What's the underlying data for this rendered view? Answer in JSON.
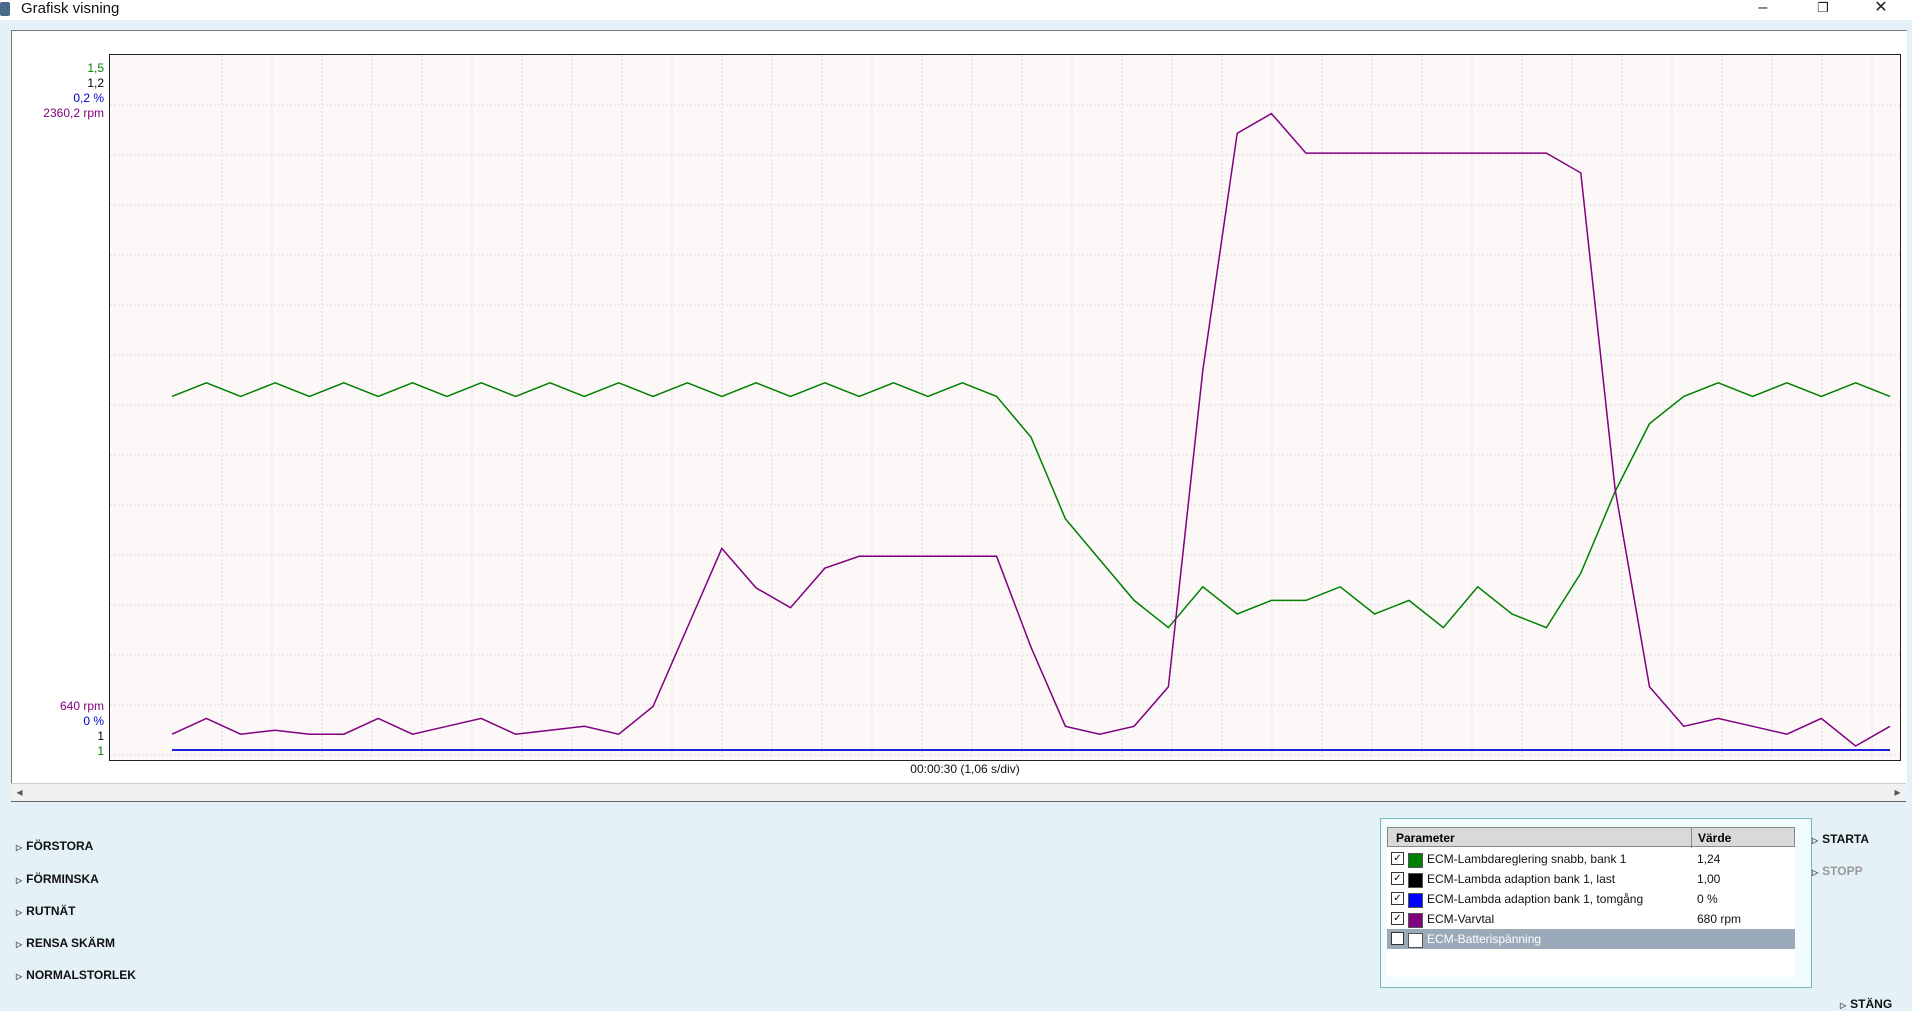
{
  "window": {
    "title": "Grafisk visning",
    "minimize": "–",
    "restore": "❐",
    "close": "✕"
  },
  "y_axis_labels_top": [
    {
      "text": "1,5",
      "color": "#008000"
    },
    {
      "text": "1,2",
      "color": "#000000"
    },
    {
      "text": "0,2 %",
      "color": "#0000cc"
    },
    {
      "text": "2360,2 rpm",
      "color": "#800080"
    }
  ],
  "y_axis_labels_bottom": [
    {
      "text": "640 rpm",
      "color": "#800080"
    },
    {
      "text": "0 %",
      "color": "#0000cc"
    },
    {
      "text": "1",
      "color": "#000000"
    },
    {
      "text": "1",
      "color": "#008000"
    }
  ],
  "x_axis_label": "00:00:30 (1,06 s/div)",
  "chart_data": {
    "type": "line",
    "x_unit": "s",
    "x": [
      0,
      1,
      2,
      3,
      4,
      5,
      6,
      7,
      8,
      9,
      10,
      11,
      12,
      13,
      14,
      15,
      16,
      17,
      18,
      19,
      20,
      21,
      22,
      23,
      24,
      25,
      26,
      27,
      28,
      29,
      30,
      31,
      32,
      33,
      34,
      35,
      36,
      37,
      38,
      39,
      40,
      41,
      42,
      43,
      44,
      45,
      46,
      47,
      48,
      49,
      50
    ],
    "series": [
      {
        "name": "ECM-Lambdareglering snabb, bank 1",
        "color": "#008000",
        "values": [
          1.26,
          1.27,
          1.26,
          1.27,
          1.26,
          1.27,
          1.26,
          1.27,
          1.26,
          1.27,
          1.26,
          1.27,
          1.26,
          1.27,
          1.26,
          1.27,
          1.26,
          1.27,
          1.26,
          1.27,
          1.26,
          1.27,
          1.26,
          1.27,
          1.26,
          1.23,
          1.17,
          1.14,
          1.11,
          1.09,
          1.12,
          1.1,
          1.11,
          1.11,
          1.12,
          1.1,
          1.11,
          1.09,
          1.12,
          1.1,
          1.09,
          1.13,
          1.19,
          1.24,
          1.26,
          1.27,
          1.26,
          1.27,
          1.26,
          1.27,
          1.26
        ],
        "ylim": [
          1.0,
          1.5
        ]
      },
      {
        "name": "ECM-Lambda adaption bank 1, last",
        "color": "#000000",
        "values": [
          1,
          1,
          1,
          1,
          1,
          1,
          1,
          1,
          1,
          1,
          1,
          1,
          1,
          1,
          1,
          1,
          1,
          1,
          1,
          1,
          1,
          1,
          1,
          1,
          1,
          1,
          1,
          1,
          1,
          1,
          1,
          1,
          1,
          1,
          1,
          1,
          1,
          1,
          1,
          1,
          1,
          1,
          1,
          1,
          1,
          1,
          1,
          1,
          1,
          1,
          1
        ],
        "ylim": [
          1.0,
          1.2
        ]
      },
      {
        "name": "ECM-Lambda adaption bank 1, tomgång",
        "color": "#0000ff",
        "values": [
          0,
          0,
          0,
          0,
          0,
          0,
          0,
          0,
          0,
          0,
          0,
          0,
          0,
          0,
          0,
          0,
          0,
          0,
          0,
          0,
          0,
          0,
          0,
          0,
          0,
          0,
          0,
          0,
          0,
          0,
          0,
          0,
          0,
          0,
          0,
          0,
          0,
          0,
          0,
          0,
          0,
          0,
          0,
          0,
          0,
          0,
          0,
          0,
          0,
          0,
          0
        ],
        "ylim": [
          0,
          0.2
        ]
      },
      {
        "name": "ECM-Varvtal",
        "color": "#800080",
        "values": [
          680,
          720,
          680,
          690,
          680,
          680,
          720,
          680,
          700,
          720,
          680,
          690,
          700,
          680,
          750,
          950,
          1150,
          1050,
          1000,
          1100,
          1130,
          1130,
          1130,
          1130,
          1130,
          900,
          700,
          680,
          700,
          800,
          1600,
          2200,
          2250,
          2150,
          2150,
          2150,
          2150,
          2150,
          2150,
          2150,
          2150,
          2100,
          1300,
          800,
          700,
          720,
          700,
          680,
          720,
          650,
          700
        ],
        "ylim": [
          640,
          2360.2
        ]
      }
    ],
    "grid": true
  },
  "side_buttons": [
    "FÖRSTORA",
    "FÖRMINSKA",
    "RUTNÄT",
    "RENSA SKÄRM",
    "NORMALSTORLEK"
  ],
  "legend": {
    "header": {
      "parameter": "Parameter",
      "value": "Värde"
    },
    "rows": [
      {
        "checked": true,
        "color": "#008000",
        "name": "ECM-Lambdareglering snabb, bank 1",
        "value": "1,24"
      },
      {
        "checked": true,
        "color": "#000000",
        "name": "ECM-Lambda adaption bank 1, last",
        "value": "1,00"
      },
      {
        "checked": true,
        "color": "#0000ff",
        "name": "ECM-Lambda adaption bank 1, tomgång",
        "value": "0 %"
      },
      {
        "checked": true,
        "color": "#800080",
        "name": "ECM-Varvtal",
        "value": "680 rpm"
      },
      {
        "checked": false,
        "color": "#ffffff",
        "name": "ECM-Batterispänning",
        "value": ""
      }
    ]
  },
  "right_buttons": {
    "start": "STARTA",
    "stop": "STOPP",
    "close": "STÄNG"
  },
  "scrollbar": {
    "left_arrow": "◂",
    "right_arrow": "▸"
  }
}
